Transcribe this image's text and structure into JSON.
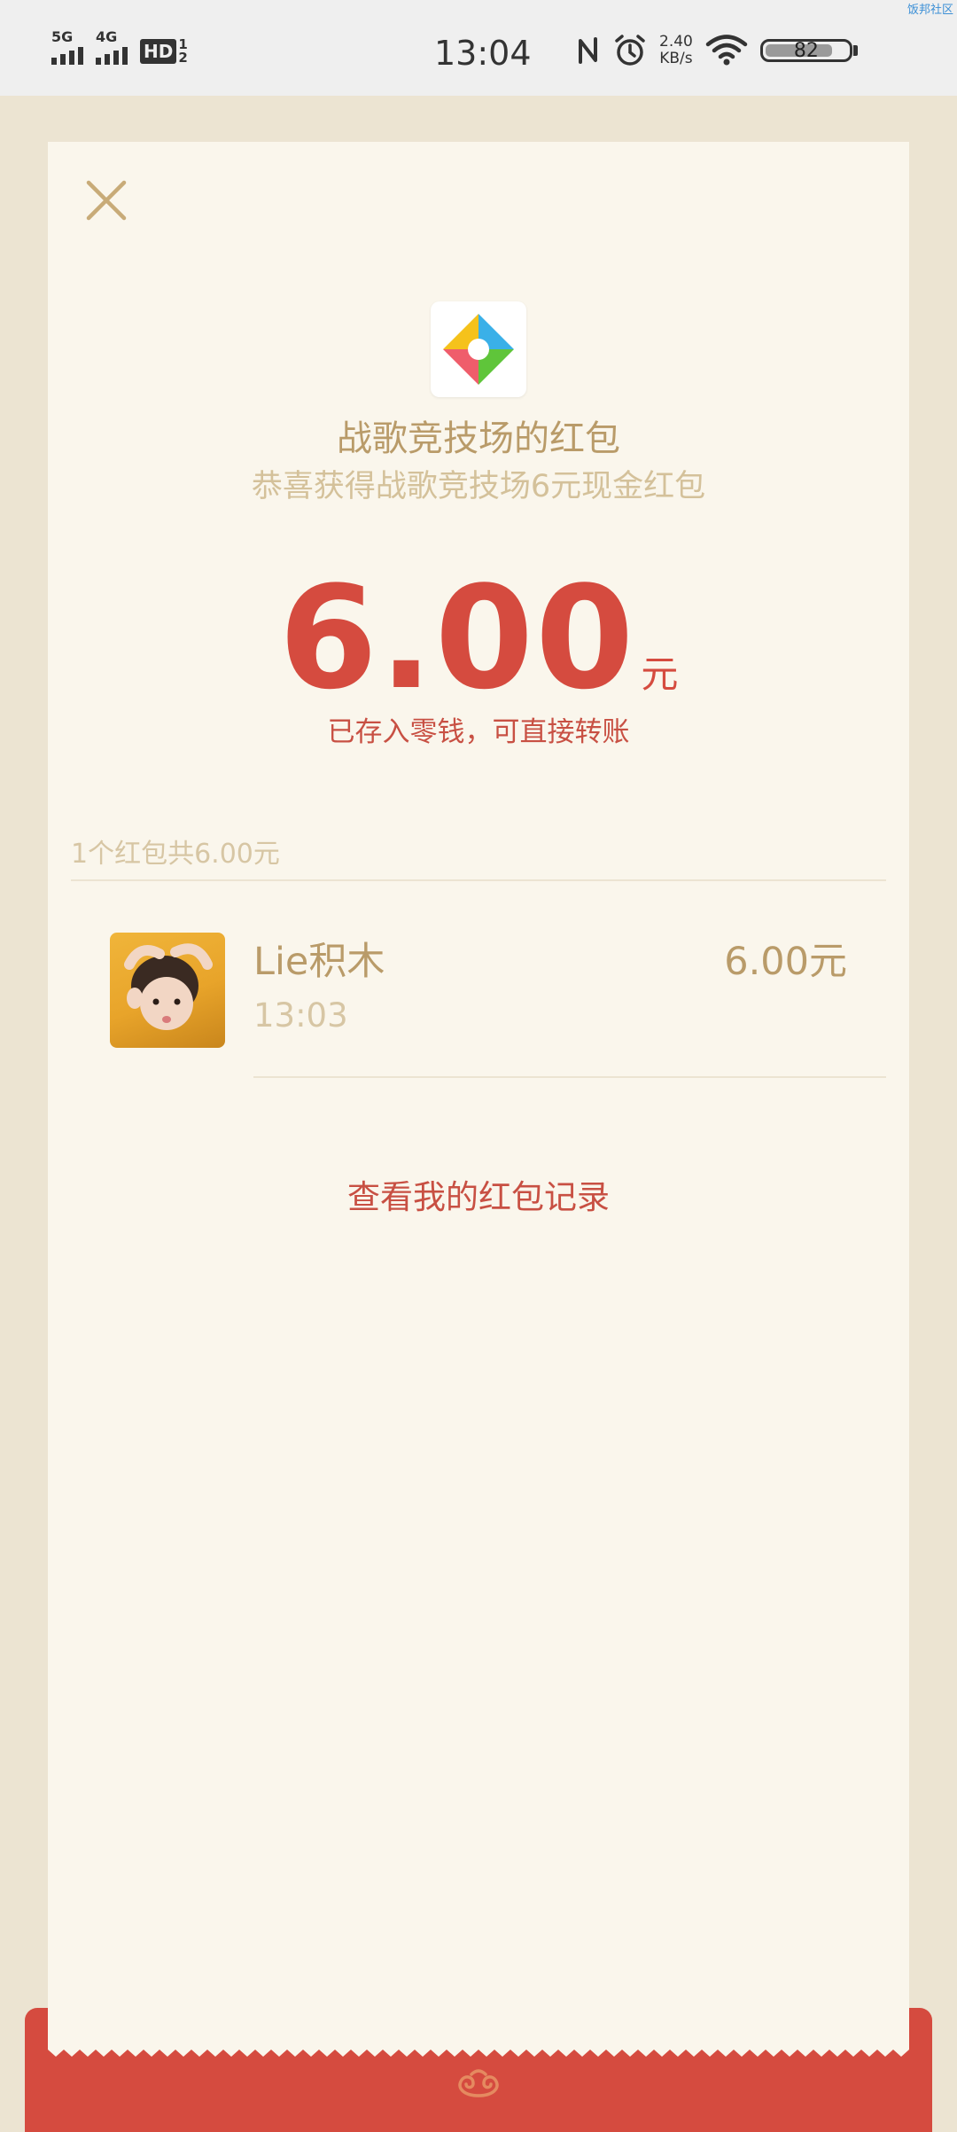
{
  "status_bar": {
    "network_1": "5G",
    "network_2": "4G",
    "hd_label": "HD",
    "hd_sub_top": "1",
    "hd_sub_bottom": "2",
    "time": "13:04",
    "speed_value": "2.40",
    "speed_unit": "KB/s",
    "battery": "82",
    "battery_level": 0.82,
    "watermark": "饭邦社区"
  },
  "packet": {
    "sender_app_title": "战歌竞技场的红包",
    "subtitle": "恭喜获得战歌竞技场6元现金红包",
    "amount": "6.00",
    "amount_unit": "元",
    "saved_note": "已存入零钱，可直接转账",
    "summary": "1个红包共6.00元",
    "view_records": "查看我的红包记录"
  },
  "receivers": [
    {
      "name": "Lie积木",
      "time": "13:03",
      "amount": "6.00元"
    }
  ],
  "colors": {
    "accent_red": "#d54b3f",
    "gold_text": "#b99b69",
    "card_bg": "#faf6ec",
    "page_bg": "#ece4d2"
  },
  "icons": [
    "close-icon",
    "app-logo-icon",
    "swirl-icon",
    "wifi-icon",
    "alarm-icon",
    "nfc-icon"
  ]
}
